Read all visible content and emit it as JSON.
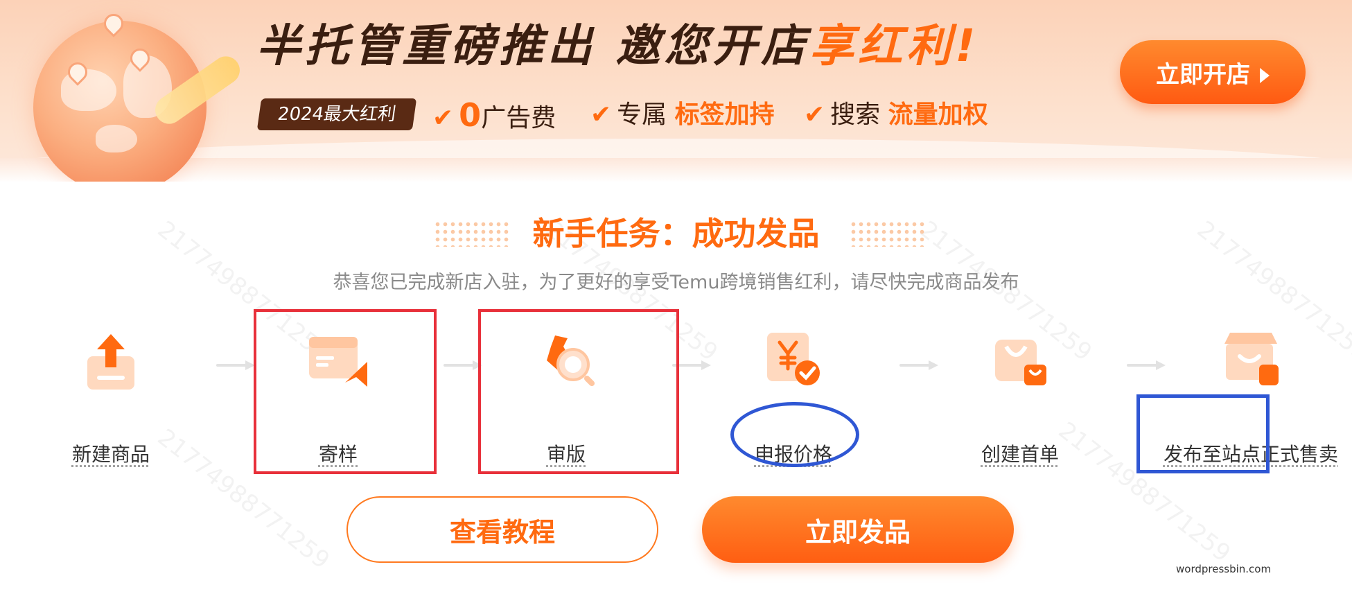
{
  "banner": {
    "headline_dark_1": "半托管重磅推出",
    "headline_dark_2": "邀您开店",
    "headline_orange": "享红利!",
    "badge": "2024最大红利",
    "perks": [
      {
        "prefix": "",
        "big": "0",
        "text": "广告费",
        "highlight": ""
      },
      {
        "prefix": "专属",
        "big": "",
        "text": "",
        "highlight": "标签加持"
      },
      {
        "prefix": "搜索",
        "big": "",
        "text": "",
        "highlight": "流量加权"
      }
    ],
    "check_glyph": "✔",
    "open_store_label": "立即开店"
  },
  "task": {
    "title": "新手任务：成功发品",
    "subtitle": "恭喜您已完成新店入驻，为了更好的享受Temu跨境销售红利，请尽快完成商品发布",
    "steps": [
      {
        "label": "新建商品",
        "icon": "upload-box-icon"
      },
      {
        "label": "寄样",
        "icon": "sample-shipping-icon"
      },
      {
        "label": "审版",
        "icon": "review-magnifier-icon"
      },
      {
        "label": "申报价格",
        "icon": "price-declare-icon"
      },
      {
        "label": "创建首单",
        "icon": "shopping-bag-icon"
      },
      {
        "label": "发布至站点正式售卖",
        "icon": "storefront-icon"
      }
    ],
    "buttons": {
      "tutorial": "查看教程",
      "publish": "立即发品"
    }
  },
  "watermark": {
    "number": "21774988771259",
    "site": "wordpressbin.com"
  },
  "colors": {
    "accent": "#ff6a10",
    "annotation_red": "#e8303a",
    "annotation_blue": "#2f57d4"
  }
}
